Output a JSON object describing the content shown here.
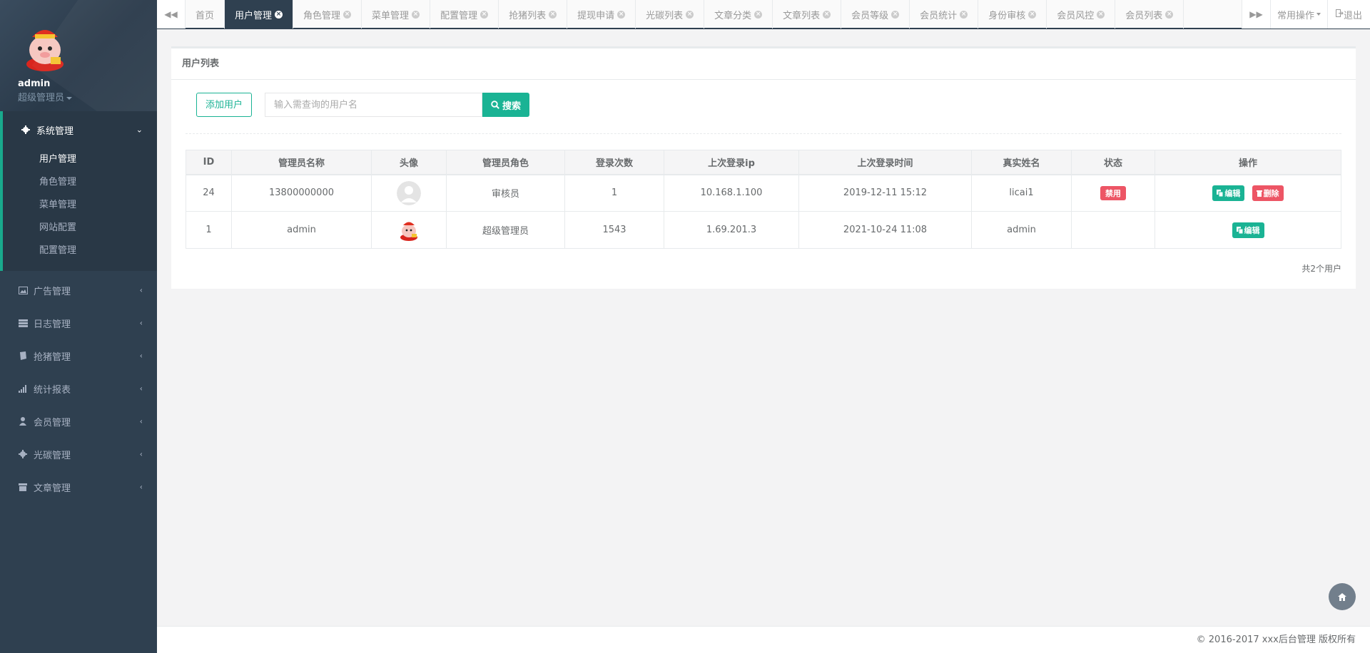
{
  "profile": {
    "name": "admin",
    "role": "超级管理员"
  },
  "sidebar": {
    "active_group": {
      "label": "系统管理",
      "icon": "gear-icon",
      "items": [
        {
          "label": "用户管理",
          "current": true
        },
        {
          "label": "角色管理"
        },
        {
          "label": "菜单管理"
        },
        {
          "label": "网站配置"
        },
        {
          "label": "配置管理"
        }
      ]
    },
    "groups": [
      {
        "label": "广告管理",
        "icon": "image-icon"
      },
      {
        "label": "日志管理",
        "icon": "log-icon"
      },
      {
        "label": "抢猪管理",
        "icon": "book-icon"
      },
      {
        "label": "统计报表",
        "icon": "bar-chart-icon"
      },
      {
        "label": "会员管理",
        "icon": "user-icon"
      },
      {
        "label": "光碳管理",
        "icon": "gear-icon"
      },
      {
        "label": "文章管理",
        "icon": "archive-icon"
      }
    ]
  },
  "tabs": [
    {
      "label": "首页"
    },
    {
      "label": "用户管理",
      "active": true
    },
    {
      "label": "角色管理"
    },
    {
      "label": "菜单管理"
    },
    {
      "label": "配置管理"
    },
    {
      "label": "抢猪列表"
    },
    {
      "label": "提现申请"
    },
    {
      "label": "光碳列表"
    },
    {
      "label": "文章分类"
    },
    {
      "label": "文章列表"
    },
    {
      "label": "会员等级"
    },
    {
      "label": "会员统计"
    },
    {
      "label": "身份审核"
    },
    {
      "label": "会员风控"
    },
    {
      "label": "会员列表"
    }
  ],
  "topbar": {
    "menu_label": "常用操作",
    "logout_label": "退出"
  },
  "panel": {
    "title": "用户列表",
    "add_label": "添加用户",
    "search_placeholder": "输入需查询的用户名",
    "search_label": "搜索",
    "columns": [
      "ID",
      "管理员名称",
      "头像",
      "管理员角色",
      "登录次数",
      "上次登录ip",
      "上次登录时间",
      "真实姓名",
      "状态",
      "操作"
    ],
    "rows": [
      {
        "id": "24",
        "name": "13800000000",
        "avatar": "default-avatar",
        "role": "审核员",
        "logins": "1",
        "ip": "10.168.1.100",
        "time": "2019-12-11 15:12",
        "realname": "licai1",
        "status": "禁用",
        "edit": "编辑",
        "delete": "删除"
      },
      {
        "id": "1",
        "name": "admin",
        "avatar": "mascot-avatar",
        "role": "超级管理员",
        "logins": "1543",
        "ip": "1.69.201.3",
        "time": "2021-10-24 11:08",
        "realname": "admin",
        "status": "",
        "edit": "编辑"
      }
    ],
    "total": "共2个用户"
  },
  "footer": {
    "text": "© 2016-2017 xxx后台管理 版权所有"
  },
  "colors": {
    "sidebar": "#2f4050",
    "accent": "#1ab394",
    "danger": "#ed5565"
  }
}
